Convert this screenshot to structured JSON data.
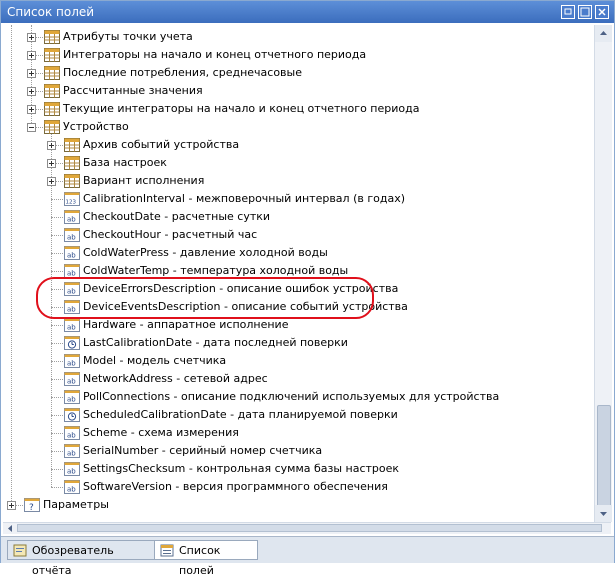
{
  "window": {
    "title": "Список полей"
  },
  "colors": {
    "highlight_oval": "#e0101b",
    "title_bar": "#3b6dbd"
  },
  "tree": {
    "rows": [
      {
        "label": "Атрибуты точки учета",
        "icon": "table-icon",
        "expander": "plus",
        "level": 1
      },
      {
        "label": "Интеграторы на начало и конец отчетного периода",
        "icon": "table-icon",
        "expander": "plus",
        "level": 1
      },
      {
        "label": "Последние потребления, среднечасовые",
        "icon": "table-icon",
        "expander": "plus",
        "level": 1
      },
      {
        "label": "Рассчитанные значения",
        "icon": "table-icon",
        "expander": "plus",
        "level": 1
      },
      {
        "label": "Текущие интеграторы на начало и конец отчетного периода",
        "icon": "table-icon",
        "expander": "plus",
        "level": 1
      },
      {
        "label": "Устройство",
        "icon": "table-icon",
        "expander": "minus",
        "level": 1
      },
      {
        "label": "Архив событий устройства",
        "icon": "table-icon",
        "expander": "plus",
        "level": 2
      },
      {
        "label": "База настроек",
        "icon": "table-icon",
        "expander": "plus",
        "level": 2
      },
      {
        "label": "Вариант исполнения",
        "icon": "table-icon",
        "expander": "plus",
        "level": 2
      },
      {
        "label": "CalibrationInterval - межповерочный интервал (в годах)",
        "icon": "number-field-icon",
        "expander": "none",
        "level": 2
      },
      {
        "label": "CheckoutDate - расчетные сутки",
        "icon": "text-field-icon",
        "expander": "none",
        "level": 2
      },
      {
        "label": "CheckoutHour - расчетный час",
        "icon": "text-field-icon",
        "expander": "none",
        "level": 2
      },
      {
        "label": "ColdWaterPress - давление холодной воды",
        "icon": "text-field-icon",
        "expander": "none",
        "level": 2
      },
      {
        "label": "ColdWaterTemp - температура холодной воды",
        "icon": "text-field-icon",
        "expander": "none",
        "level": 2
      },
      {
        "label": "DeviceErrorsDescription - описание ошибок устройства",
        "icon": "text-field-icon",
        "expander": "none",
        "level": 2
      },
      {
        "label": "DeviceEventsDescription - описание событий устройства",
        "icon": "text-field-icon",
        "expander": "none",
        "level": 2
      },
      {
        "label": "Hardware - аппаратное исполнение",
        "icon": "text-field-icon",
        "expander": "none",
        "level": 2
      },
      {
        "label": "LastCalibrationDate - дата последней поверки",
        "icon": "date-field-icon",
        "expander": "none",
        "level": 2
      },
      {
        "label": "Model - модель счетчика",
        "icon": "text-field-icon",
        "expander": "none",
        "level": 2
      },
      {
        "label": "NetworkAddress - сетевой адрес",
        "icon": "text-field-icon",
        "expander": "none",
        "level": 2
      },
      {
        "label": "PollConnections - описание подключений используемых для устройства",
        "icon": "text-field-icon",
        "expander": "none",
        "level": 2
      },
      {
        "label": "ScheduledCalibrationDate - дата планируемой поверки",
        "icon": "date-field-icon",
        "expander": "none",
        "level": 2
      },
      {
        "label": "Scheme - схема измерения",
        "icon": "text-field-icon",
        "expander": "none",
        "level": 2
      },
      {
        "label": "SerialNumber - серийный номер счетчика",
        "icon": "text-field-icon",
        "expander": "none",
        "level": 2
      },
      {
        "label": "SettingsChecksum - контрольная сумма базы настроек",
        "icon": "text-field-icon",
        "expander": "none",
        "level": 2
      },
      {
        "label": "SoftwareVersion - версия программного обеспечения",
        "icon": "text-field-icon",
        "expander": "none",
        "level": 2
      },
      {
        "label": "Параметры",
        "icon": "parameters-icon",
        "expander": "plus",
        "level": 0
      }
    ]
  },
  "tabs": [
    {
      "label": "Обозреватель отчёта",
      "icon": "report-explorer-icon",
      "active": false
    },
    {
      "label": "Список полей",
      "icon": "field-list-icon",
      "active": true
    }
  ]
}
